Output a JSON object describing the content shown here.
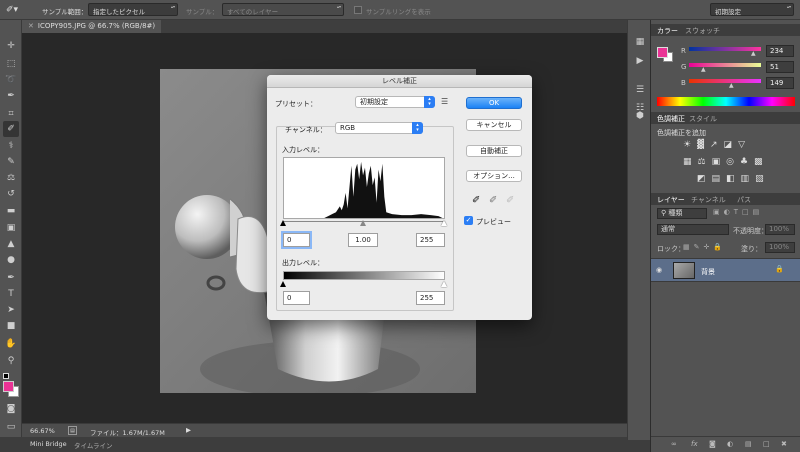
{
  "options_bar": {
    "sample_size_label": "サンプル範囲：",
    "sample_size_value": "指定したピクセル",
    "sample_label": "サンプル：",
    "sample_value": "すべてのレイヤー",
    "sample_ring_label": "サンプルリングを表示",
    "workspace_value": "初期設定"
  },
  "document": {
    "tab_title": "ICOPY905.JPG @ 66.7% (RGB/8#)"
  },
  "status": {
    "zoom": "66.67%",
    "file_info": "ファイル：1.67M/1.67M"
  },
  "bottom_tabs": [
    "Mini Bridge",
    "タイムライン"
  ],
  "color_panel": {
    "tabs": [
      "カラー",
      "スウォッチ"
    ],
    "r_label": "R",
    "g_label": "G",
    "b_label": "B",
    "r_value": "234",
    "g_value": "51",
    "b_value": "149",
    "foreground_color": "#ea3395",
    "r": 234,
    "g": 51,
    "b": 149
  },
  "adjustments_panel": {
    "tabs": [
      "色調補正",
      "スタイル"
    ],
    "add_label": "色調補正を追加"
  },
  "layers_panel": {
    "tabs": [
      "レイヤー",
      "チャンネル",
      "パス"
    ],
    "kind_value": "種類",
    "blend_mode": "通常",
    "opacity_label": "不透明度：",
    "opacity_value": "100%",
    "lock_label": "ロック：",
    "fill_label": "塗り：",
    "fill_value": "100%",
    "layer_name": "背景"
  },
  "levels_dialog": {
    "title": "レベル補正",
    "preset_label": "プリセット：",
    "preset_value": "初期設定",
    "channel_label": "チャンネル：",
    "channel_value": "RGB",
    "input_levels_label": "入力レベル：",
    "input_black": "0",
    "input_gamma": "1.00",
    "input_white": "255",
    "output_levels_label": "出力レベル：",
    "output_black": "0",
    "output_white": "255",
    "ok_label": "OK",
    "cancel_label": "キャンセル",
    "auto_label": "自動補正",
    "options_label": "オプション...",
    "preview_label": "プレビュー",
    "preview_checked": true
  }
}
